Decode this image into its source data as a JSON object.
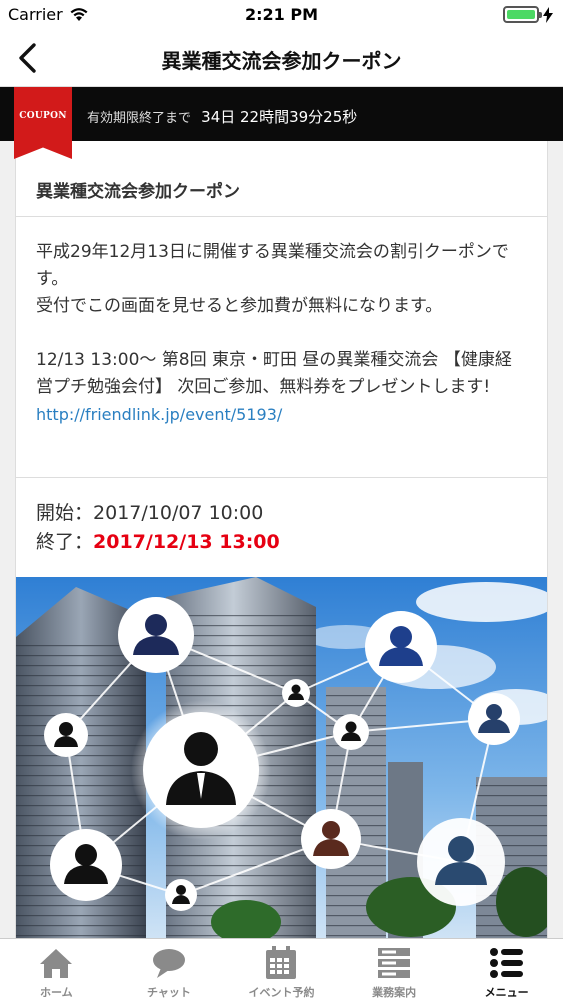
{
  "status_bar": {
    "carrier": "Carrier",
    "time": "2:21 PM"
  },
  "nav": {
    "title": "異業種交流会参加クーポン"
  },
  "coupon": {
    "ribbon_label": "COUPON",
    "expiry_label": "有効期限終了まで",
    "countdown": "34日 22時間39分25秒"
  },
  "card": {
    "title": "異業種交流会参加クーポン",
    "description": {
      "line1": "平成29年12月13日に開催する異業種交流会の割引クーポンです。",
      "line2": "受付でこの画面を見せると参加費が無料になります。",
      "line3": "12/13 13:00～ 第8回 東京・町田 昼の異業種交流会 【健康経営プチ勉強会付】 次回ご参加、無料券をプレゼントします!",
      "link": "http://friendlink.jp/event/5193/"
    },
    "start_label": "開始：",
    "start_value": "2017/10/07 10:00",
    "end_label": "終了：",
    "end_value": "2017/12/13 13:00"
  },
  "tabs": [
    {
      "label": "ホーム",
      "icon": "home-icon"
    },
    {
      "label": "チャット",
      "icon": "chat-icon"
    },
    {
      "label": "イベント予約",
      "icon": "calendar-icon"
    },
    {
      "label": "業務案内",
      "icon": "server-icon"
    },
    {
      "label": "メニュー",
      "icon": "menu-list-icon"
    }
  ],
  "colors": {
    "accent_red": "#e60012",
    "link_blue": "#2a7fc1",
    "ribbon_red": "#d21a1a",
    "battery_green": "#4cd964"
  }
}
